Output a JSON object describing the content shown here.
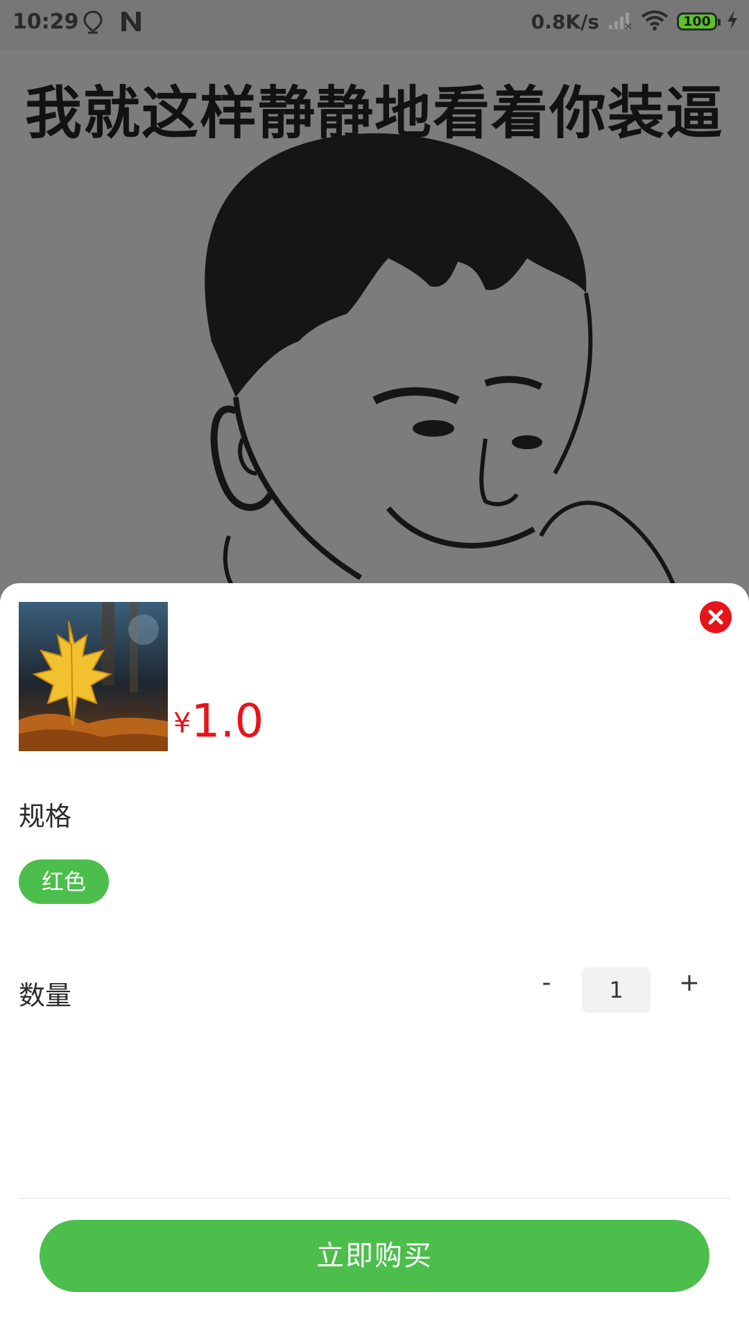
{
  "status_bar": {
    "time": "10:29",
    "net_speed": "0.8K/s",
    "battery": "100",
    "icons": [
      "location-pin-icon",
      "n-app-icon",
      "signal-icon",
      "wifi-icon",
      "battery-icon",
      "charging-bolt-icon"
    ]
  },
  "background": {
    "caption": "我就这样静静地看着你装逼"
  },
  "sheet": {
    "price": {
      "symbol": "¥",
      "value": "1.0"
    },
    "spec_section": {
      "label": "规格",
      "options": [
        "红色"
      ],
      "selected": "红色"
    },
    "quantity_section": {
      "label": "数量",
      "minus": "-",
      "value": "1",
      "plus": "+"
    },
    "buy_button": "立即购买"
  },
  "colors": {
    "accent_green": "#4cbe4c",
    "price_red": "#e8141b",
    "overlay_gray": "#777777"
  }
}
